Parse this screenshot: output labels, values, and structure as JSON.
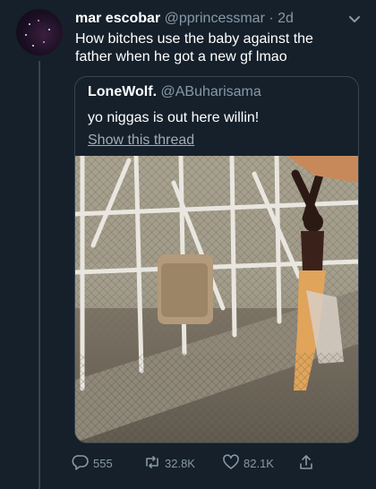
{
  "tweet": {
    "display_name": "mar escobar",
    "handle": "@pprincessmar",
    "separator": "·",
    "time": "2d",
    "text": "How bitches use the baby against the father when he got a new gf lmao"
  },
  "quoted": {
    "display_name": "LoneWolf.",
    "handle": "@ABuharisama",
    "text": "yo niggas is out here willin!",
    "show_thread_label": "Show this thread"
  },
  "actions": {
    "replies": "555",
    "retweets": "32.8K",
    "likes": "82.1K"
  },
  "icons": {
    "menu": "chevron-down-icon",
    "reply": "reply-icon",
    "retweet": "retweet-icon",
    "like": "heart-icon",
    "share": "share-icon"
  },
  "colors": {
    "background": "#15202b",
    "primary_text": "#ffffff",
    "secondary_text": "#8899a6",
    "border": "#38444d"
  }
}
